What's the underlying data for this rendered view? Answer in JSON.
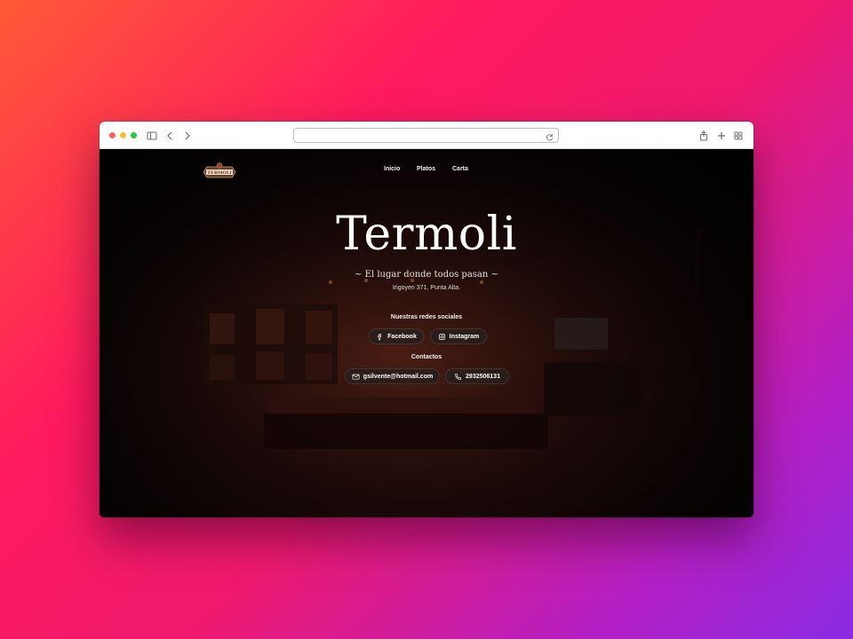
{
  "browser": {
    "url": ""
  },
  "site": {
    "logo_text": "TERMOLI",
    "nav": [
      "Inicio",
      "Platos",
      "Carta"
    ],
    "title": "Termoli",
    "subtitle": "~ El lugar donde todos pasan ~",
    "address": "Irigoyen 371, Punta Alta.",
    "social_heading": "Nuestras redes sociales",
    "social": [
      {
        "label": "Facebook",
        "icon": "facebook-icon"
      },
      {
        "label": "Instagram",
        "icon": "instagram-icon"
      }
    ],
    "contact_heading": "Contactos",
    "contacts": [
      {
        "label": "gsilvente@hotmail.com",
        "icon": "mail-icon"
      },
      {
        "label": "2932506131",
        "icon": "phone-icon"
      }
    ]
  },
  "colors": {
    "background_gradient": [
      "#ff5a36",
      "#ff1a5e",
      "#b41fc4",
      "#8a2be2"
    ],
    "page_bg": "#000000",
    "text": "#ffffff"
  }
}
